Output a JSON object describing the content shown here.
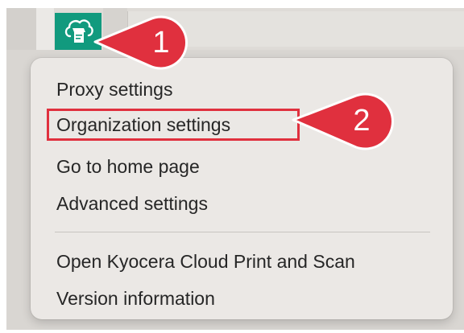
{
  "app_icon": {
    "name": "kyocera-cloud-icon",
    "color": "#119a7e"
  },
  "menu": {
    "items": [
      {
        "label": "Proxy settings"
      },
      {
        "label": "Organization settings"
      },
      {
        "label": "Go to home page"
      },
      {
        "label": "Advanced settings"
      },
      {
        "label": "Open Kyocera Cloud Print and Scan"
      },
      {
        "label": "Version information"
      }
    ]
  },
  "callouts": [
    {
      "number": "1",
      "color": "#e0303e"
    },
    {
      "number": "2",
      "color": "#e0303e"
    }
  ]
}
